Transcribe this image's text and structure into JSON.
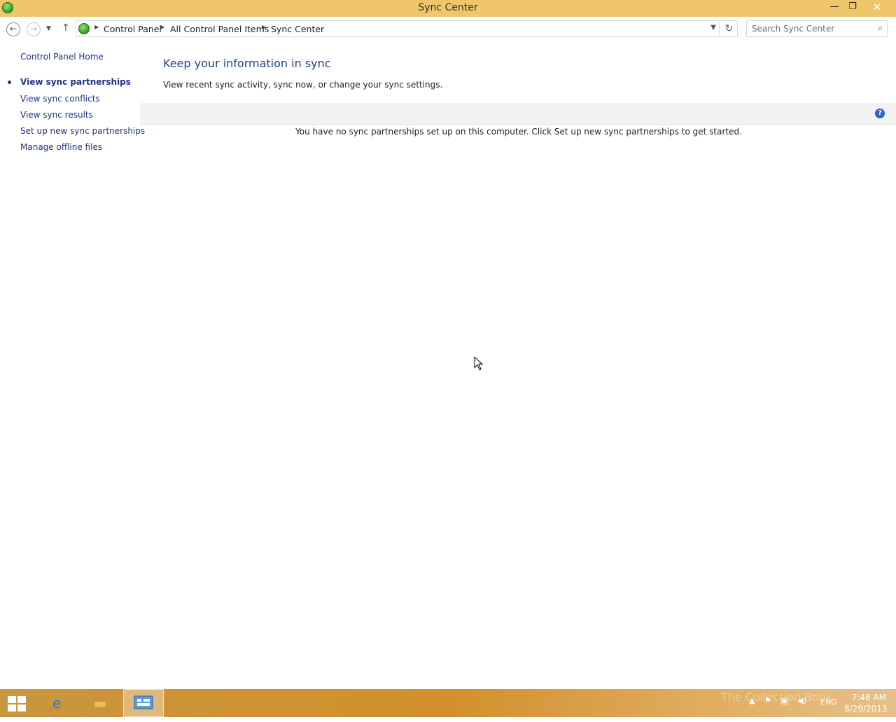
{
  "window": {
    "title": "Sync Center",
    "min_label": "—",
    "max_label": "❐",
    "close_label": "✕"
  },
  "address": {
    "crumbs": [
      "Control Panel",
      "All Control Panel Items",
      "Sync Center"
    ],
    "search_placeholder": "Search Sync Center"
  },
  "sidebar": {
    "items": [
      {
        "label": "Control Panel Home"
      },
      {
        "label": "View sync partnerships"
      },
      {
        "label": "View sync conflicts"
      },
      {
        "label": "View sync results"
      },
      {
        "label": "Set up new sync partnerships"
      },
      {
        "label": "Manage offline files"
      }
    ]
  },
  "main": {
    "heading": "Keep your information in sync",
    "subtitle": "View recent sync activity, sync now, or change your sync settings.",
    "help_label": "?",
    "empty_message": "You have no sync partnerships set up on this computer. Click Set up new sync partnerships to get started."
  },
  "taskbar": {
    "language": "ENG",
    "time": "7:48 AM",
    "date": "8/29/2013",
    "watermark": "The Collection Book"
  },
  "icons": [
    "sync-center-icon",
    "back-arrow-icon",
    "forward-arrow-icon",
    "recent-pages-icon",
    "up-arrow-icon",
    "refresh-icon",
    "search-icon",
    "help-icon",
    "windows-start-icon",
    "internet-explorer-icon",
    "file-explorer-icon",
    "control-panel-icon"
  ]
}
